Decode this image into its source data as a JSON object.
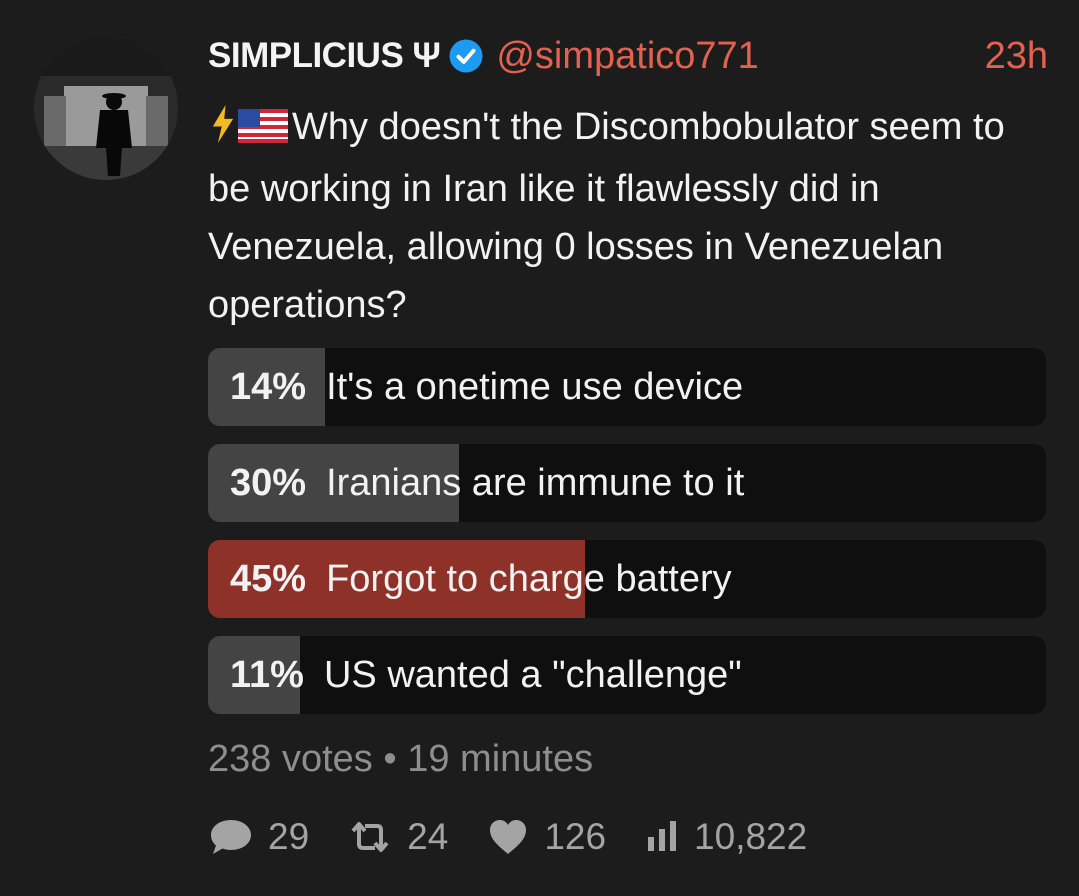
{
  "post": {
    "author_name": "SIMPLICIUS Ψ",
    "handle": "@simpatico771",
    "time": "23h",
    "text": "Why doesn't the Discombobulator seem to be working in Iran like it flawlessly did in Venezuela, allowing 0 losses in Venezuelan operations?",
    "icons": [
      "lightning-emoji",
      "us-flag-emoji"
    ]
  },
  "poll": {
    "options": [
      {
        "percent": "14%",
        "label": "It's a onetime use device",
        "fraction": 0.14,
        "winner": false
      },
      {
        "percent": "30%",
        "label": "Iranians are immune to it",
        "fraction": 0.3,
        "winner": false
      },
      {
        "percent": "45%",
        "label": "Forgot to charge battery",
        "fraction": 0.45,
        "winner": true
      },
      {
        "percent": "11%",
        "label": "US wanted a \"challenge\"",
        "fraction": 0.11,
        "winner": false
      }
    ],
    "votes": "238 votes",
    "separator": "•",
    "remaining": "19 minutes"
  },
  "actions": {
    "replies": "29",
    "reposts": "24",
    "likes": "126",
    "views": "10,822"
  },
  "colors": {
    "accent": "#e2614f",
    "winner_fill": "#8e3229",
    "option_fill": "#444444",
    "verified": "#1d9bf0"
  }
}
